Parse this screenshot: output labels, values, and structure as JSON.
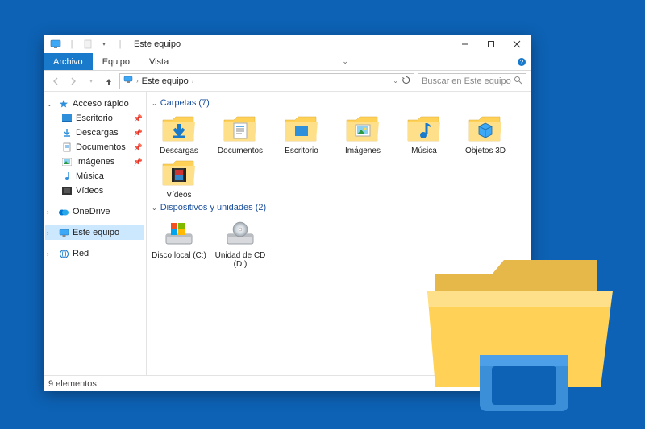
{
  "titlebar": {
    "title": "Este equipo"
  },
  "ribbon": {
    "file": "Archivo",
    "tabs": [
      "Equipo",
      "Vista"
    ]
  },
  "nav": {
    "crumb": "Este equipo",
    "search_placeholder": "Buscar en Este equipo"
  },
  "sidebar": {
    "quick_label": "Acceso rápido",
    "quick": [
      {
        "label": "Escritorio"
      },
      {
        "label": "Descargas"
      },
      {
        "label": "Documentos"
      },
      {
        "label": "Imágenes"
      },
      {
        "label": "Música"
      },
      {
        "label": "Vídeos"
      }
    ],
    "onedrive": "OneDrive",
    "thispc": "Este equipo",
    "network": "Red"
  },
  "sections": {
    "folders_label": "Carpetas (7)",
    "folders": [
      {
        "label": "Descargas"
      },
      {
        "label": "Documentos"
      },
      {
        "label": "Escritorio"
      },
      {
        "label": "Imágenes"
      },
      {
        "label": "Música"
      },
      {
        "label": "Objetos 3D"
      },
      {
        "label": "Vídeos"
      }
    ],
    "drives_label": "Dispositivos y unidades (2)",
    "drives": [
      {
        "label": "Disco local (C:)"
      },
      {
        "label": "Unidad de CD (D:)"
      }
    ]
  },
  "status": {
    "count": "9 elementos"
  }
}
